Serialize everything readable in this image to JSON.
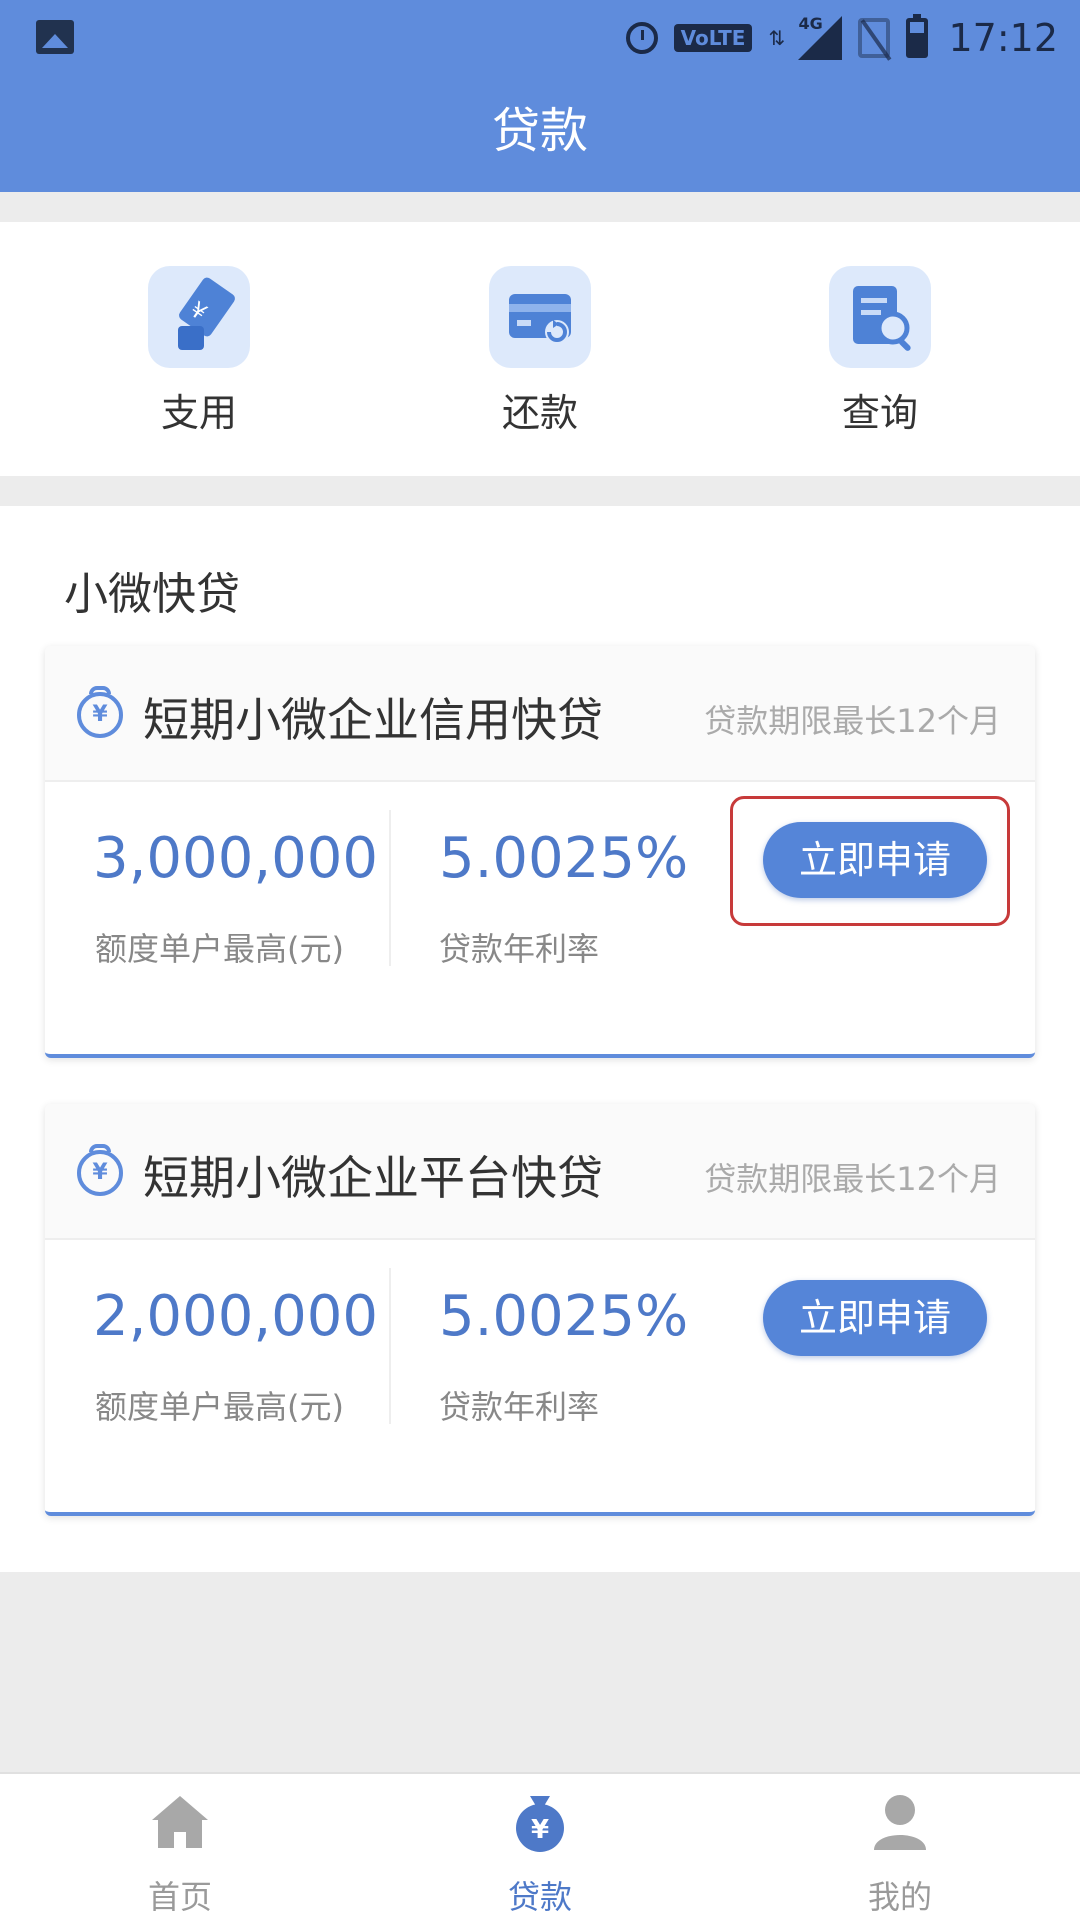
{
  "status_bar": {
    "network_badge": "VoLTE",
    "signal_type": "4G",
    "time": "17:12"
  },
  "header": {
    "title": "贷款"
  },
  "actions": [
    {
      "label": "支用",
      "icon": "hand-yuan-card-icon"
    },
    {
      "label": "还款",
      "icon": "card-return-icon"
    },
    {
      "label": "查询",
      "icon": "document-search-icon"
    }
  ],
  "section": {
    "title": "小微快贷"
  },
  "loans": [
    {
      "name": "短期小微企业信用快贷",
      "term": "贷款期限最长12个月",
      "amount": "3,000,000",
      "amount_label": "额度单户最高(元)",
      "rate": "5.0025%",
      "rate_label": "贷款年利率",
      "apply_label": "立即申请",
      "highlighted": true
    },
    {
      "name": "短期小微企业平台快贷",
      "term": "贷款期限最长12个月",
      "amount": "2,000,000",
      "amount_label": "额度单户最高(元)",
      "rate": "5.0025%",
      "rate_label": "贷款年利率",
      "apply_label": "立即申请",
      "highlighted": false
    }
  ],
  "tabs": [
    {
      "label": "首页",
      "icon": "home-icon",
      "active": false
    },
    {
      "label": "贷款",
      "icon": "money-bag-icon",
      "active": true
    },
    {
      "label": "我的",
      "icon": "person-icon",
      "active": false
    }
  ],
  "colors": {
    "primary": "#5f8cdc",
    "value_text": "#4e79c8",
    "highlight_border": "#c73a3a"
  },
  "yuan_symbol": "¥"
}
